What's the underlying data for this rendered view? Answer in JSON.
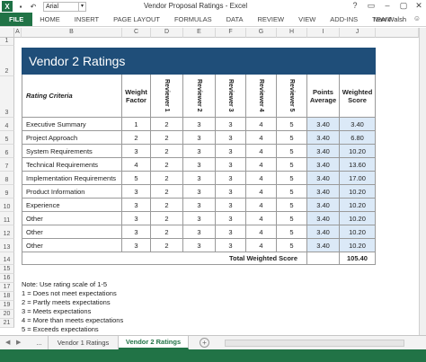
{
  "app": {
    "title": "Vendor Proposal Ratings - Excel",
    "icon_label": "X",
    "font_name": "Arial",
    "user": "Ivan Walsh",
    "window_controls": [
      "?",
      "▭",
      "–",
      "▢",
      "✕"
    ]
  },
  "ribbon": {
    "tabs": [
      "FILE",
      "HOME",
      "INSERT",
      "PAGE LAYOUT",
      "FORMULAS",
      "DATA",
      "REVIEW",
      "VIEW",
      "ADD-INS",
      "TEAM"
    ]
  },
  "columns": [
    "A",
    "B",
    "C",
    "D",
    "E",
    "F",
    "G",
    "H",
    "I",
    "J"
  ],
  "rows": [
    "1",
    "2",
    "3",
    "4",
    "5",
    "6",
    "7",
    "8",
    "9",
    "10",
    "11",
    "12",
    "13",
    "14",
    "15",
    "16",
    "17",
    "18",
    "19",
    "20",
    "21"
  ],
  "sheet": {
    "banner": "Vendor 2 Ratings",
    "headers": {
      "criteria": "Rating Criteria",
      "weight": "Weight Factor",
      "reviewers": [
        "Reviewer 1",
        "Reviewer 2",
        "Reviewer 3",
        "Reviewer 4",
        "Reviewer 5"
      ],
      "points": "Points Average",
      "weighted": "Weighted Score"
    },
    "rows": [
      {
        "criteria": "Executive Summary",
        "weight": "1",
        "r": [
          "2",
          "3",
          "3",
          "4",
          "5"
        ],
        "avg": "3.40",
        "score": "3.40"
      },
      {
        "criteria": "Project Approach",
        "weight": "2",
        "r": [
          "2",
          "3",
          "3",
          "4",
          "5"
        ],
        "avg": "3.40",
        "score": "6.80"
      },
      {
        "criteria": "System Requirements",
        "weight": "3",
        "r": [
          "2",
          "3",
          "3",
          "4",
          "5"
        ],
        "avg": "3.40",
        "score": "10.20"
      },
      {
        "criteria": "Technical Requirements",
        "weight": "4",
        "r": [
          "2",
          "3",
          "3",
          "4",
          "5"
        ],
        "avg": "3.40",
        "score": "13.60"
      },
      {
        "criteria": "Implementation Requirements",
        "weight": "5",
        "r": [
          "2",
          "3",
          "3",
          "4",
          "5"
        ],
        "avg": "3.40",
        "score": "17.00"
      },
      {
        "criteria": "Product Information",
        "weight": "3",
        "r": [
          "2",
          "3",
          "3",
          "4",
          "5"
        ],
        "avg": "3.40",
        "score": "10.20"
      },
      {
        "criteria": "Experience",
        "weight": "3",
        "r": [
          "2",
          "3",
          "3",
          "4",
          "5"
        ],
        "avg": "3.40",
        "score": "10.20"
      },
      {
        "criteria": "Other",
        "weight": "3",
        "r": [
          "2",
          "3",
          "3",
          "4",
          "5"
        ],
        "avg": "3.40",
        "score": "10.20"
      },
      {
        "criteria": "Other",
        "weight": "3",
        "r": [
          "2",
          "3",
          "3",
          "4",
          "5"
        ],
        "avg": "3.40",
        "score": "10.20"
      },
      {
        "criteria": "Other",
        "weight": "3",
        "r": [
          "2",
          "3",
          "3",
          "4",
          "5"
        ],
        "avg": "3.40",
        "score": "10.20"
      }
    ],
    "total_label": "Total Weighted Score",
    "total_value": "105.40",
    "notes": [
      "Note: Use rating scale of 1-5",
      "1 = Does not meet expectations",
      "2 = Partly meets expectations",
      "3 = Meets expectations",
      "4 = More than meets expectations",
      "5 = Exceeds expectations"
    ]
  },
  "sheet_tabs": {
    "nav_prev": "◀",
    "nav_next": "▶",
    "more": "...",
    "tabs": [
      "Vendor 1 Ratings",
      "Vendor 2 Ratings"
    ],
    "active": "Vendor 2 Ratings",
    "add": "+"
  },
  "colors": {
    "excel_green": "#217346",
    "banner": "#1f4e79",
    "score_fill": "#dbe9f7"
  }
}
